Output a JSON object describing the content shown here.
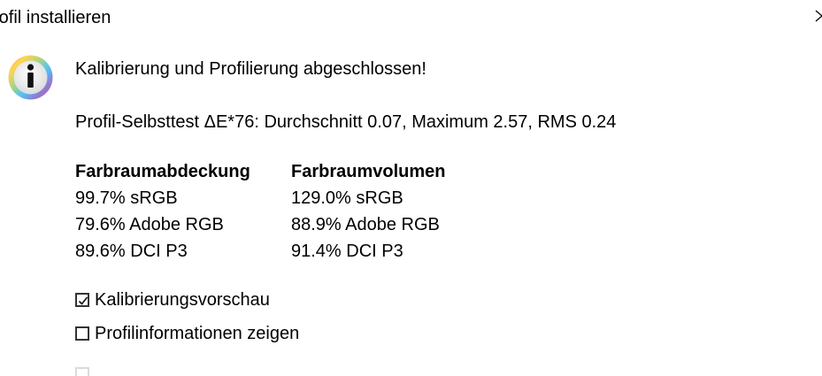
{
  "window": {
    "title": "rofil installieren",
    "close_icon": "close-icon"
  },
  "dialog": {
    "info_icon": "info-icon",
    "heading": "Kalibrierung und Profilierung abgeschlossen!",
    "selftest": "Profil-Selbsttest ΔE*76: Durchschnitt 0.07, Maximum 2.57, RMS 0.24",
    "coverage": {
      "title": "Farbraumabdeckung",
      "rows": [
        "99.7% sRGB",
        "79.6% Adobe RGB",
        "89.6% DCI P3"
      ]
    },
    "volume": {
      "title": "Farbraumvolumen",
      "rows": [
        "129.0% sRGB",
        "88.9% Adobe RGB",
        "91.4% DCI P3"
      ]
    },
    "checkboxes": [
      {
        "label": "Kalibrierungsvorschau",
        "checked": true
      },
      {
        "label": "Profilinformationen zeigen",
        "checked": false
      },
      {
        "label": "",
        "checked": false
      }
    ]
  }
}
